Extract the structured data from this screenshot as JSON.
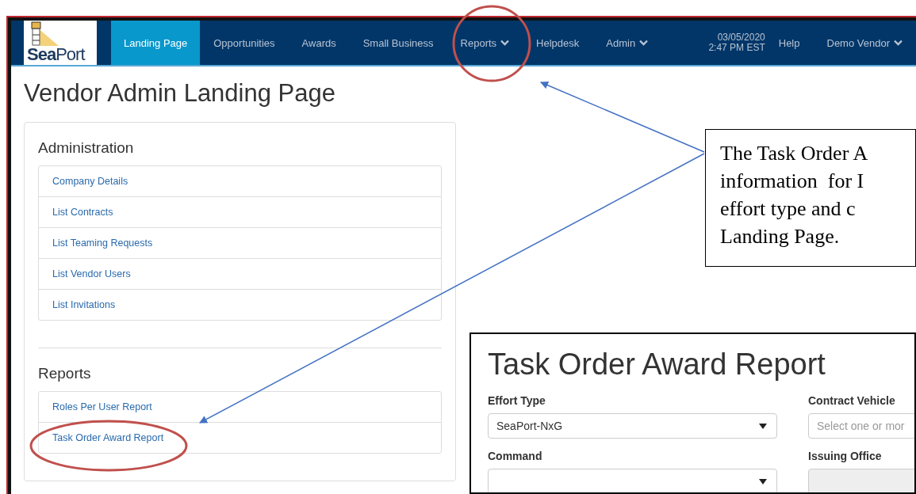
{
  "nav": {
    "logo": "**Sea**Port",
    "items": [
      {
        "label": "Landing Page",
        "selected": true,
        "dropdown": false
      },
      {
        "label": "Opportunities",
        "selected": false,
        "dropdown": false
      },
      {
        "label": "Awards",
        "selected": false,
        "dropdown": false
      },
      {
        "label": "Small Business",
        "selected": false,
        "dropdown": false
      },
      {
        "label": "Reports",
        "selected": false,
        "dropdown": true
      },
      {
        "label": "Helpdesk",
        "selected": false,
        "dropdown": false
      },
      {
        "label": "Admin",
        "selected": false,
        "dropdown": true
      }
    ],
    "date": "03/05/2020",
    "time": "2:47 PM EST",
    "right_items": [
      {
        "label": "Help",
        "dropdown": false
      },
      {
        "label": "Demo Vendor",
        "dropdown": true
      }
    ]
  },
  "page_title": "Vendor Admin Landing Page",
  "sections": [
    {
      "heading": "Administration",
      "links": [
        "Company Details",
        "List Contracts",
        "List Teaming Requests",
        "List Vendor Users",
        "List Invitations"
      ]
    },
    {
      "heading": "Reports",
      "links": [
        "Roles Per User Report",
        "Task Order Award Report"
      ]
    }
  ],
  "callout": {
    "lines": [
      "The Task Order A",
      "information  for I",
      "effort type and c",
      "Landing Page."
    ]
  },
  "inset": {
    "title": "Task Order Award Report",
    "fields": [
      {
        "label": "Effort Type",
        "kind": "select",
        "value": "SeaPort-NxG"
      },
      {
        "label": "Contract Vehicle",
        "kind": "multiselect",
        "placeholder": "Select one or mor"
      },
      {
        "label": "Command",
        "kind": "select"
      },
      {
        "label": "Issuing Office",
        "kind": "disabled"
      }
    ]
  }
}
